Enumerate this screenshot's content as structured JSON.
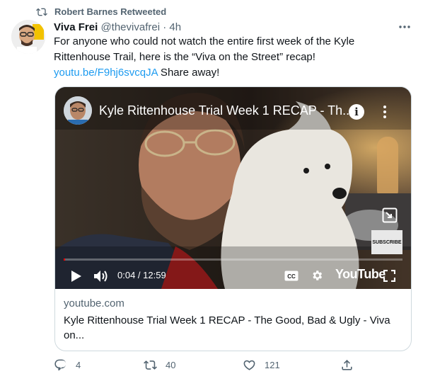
{
  "retweet": {
    "label": "Robert Barnes Retweeted",
    "icon": "retweet-icon"
  },
  "tweet": {
    "author_name": "Viva Frei",
    "handle": "@thevivafrei",
    "separator": "·",
    "time": "4h",
    "text_part1": "For anyone who could not watch the entire first week of the Kyle Rittenhouse Trail, here is the “Viva on the Street” recap! ",
    "link_text": "youtu.be/F9hj6svcqJA",
    "text_part2": " Share away!"
  },
  "video": {
    "title": "Kyle Rittenhouse Trial Week 1 RECAP - Th...",
    "info_glyph": "i",
    "subscribe_label": "SUBSCRIBE",
    "time_readout": "0:04 / 12:59",
    "progress": 0.005,
    "logo_text": "YouTube",
    "colors": {
      "progress": "#ff0000",
      "controls": "#ffffff"
    }
  },
  "card": {
    "domain": "youtube.com",
    "title": "Kyle Rittenhouse Trial Week 1 RECAP - The Good, Bad & Ugly - Viva on..."
  },
  "actions": {
    "reply_count": "4",
    "retweet_count": "40",
    "like_count": "121"
  },
  "colors": {
    "accent": "#1d9bf0",
    "secondary_text": "#536471",
    "border": "#cfd9de"
  }
}
